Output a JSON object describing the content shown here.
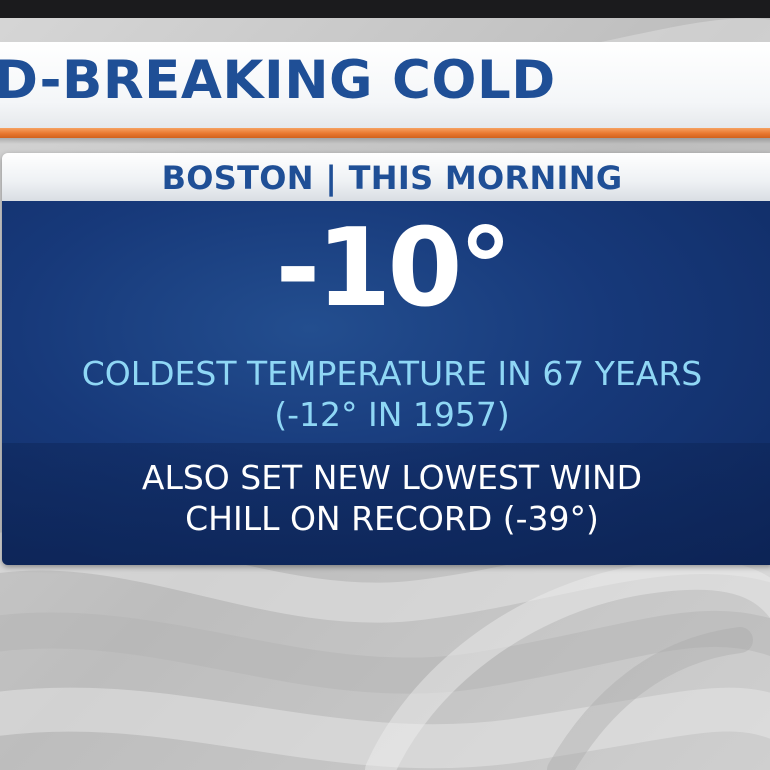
{
  "headline": {
    "text": "D-BREAKING COLD"
  },
  "subhead": {
    "text": "BOSTON | THIS MORNING"
  },
  "temperature": {
    "value": "-10°"
  },
  "record": {
    "line1": "COLDEST TEMPERATURE IN 67 YEARS",
    "line2": "(-12° IN 1957)"
  },
  "windchill": {
    "line1": "ALSO SET NEW LOWEST WIND",
    "line2": "CHILL ON RECORD (-39°)"
  },
  "colors": {
    "headline_blue": "#1f4f96",
    "accent_orange": "#e8772f",
    "panel_navy": "#17397a",
    "record_cyan": "#8fd7f5"
  }
}
